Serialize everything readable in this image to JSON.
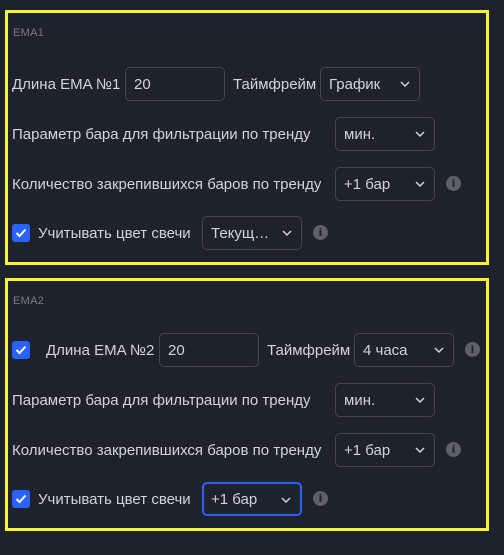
{
  "sections": [
    {
      "title": "EMA1",
      "length_label": "Длина EMA №1",
      "length_value": "20",
      "timeframe_label": "Таймфрейм",
      "timeframe_value": "График",
      "filter_label": "Параметр бара для фильтрации по тренду",
      "filter_value": "мин.",
      "bars_label": "Количество закрепившихся баров по тренду",
      "bars_value": "+1 бар",
      "candle_label": "Учитывать цвет свечи",
      "candle_checked": true,
      "candle_value": "Текущий бар"
    },
    {
      "title": "EMA2",
      "length_checked": true,
      "length_label": "Длина EMA №2",
      "length_value": "20",
      "timeframe_label": "Таймфрейм",
      "timeframe_value": "4 часа",
      "filter_label": "Параметр бара для фильтрации по тренду",
      "filter_value": "мин.",
      "bars_label": "Количество закрепившихся баров по тренду",
      "bars_value": "+1 бар",
      "candle_label": "Учитывать цвет свечи",
      "candle_checked": true,
      "candle_value": "+1 бар"
    }
  ],
  "icons": {
    "info": "info-icon",
    "chevron": "chevron-down-icon",
    "check": "checkmark-icon"
  },
  "colors": {
    "highlight_border": "#f5f536",
    "accent": "#2962ff",
    "background": "#1e222d"
  }
}
